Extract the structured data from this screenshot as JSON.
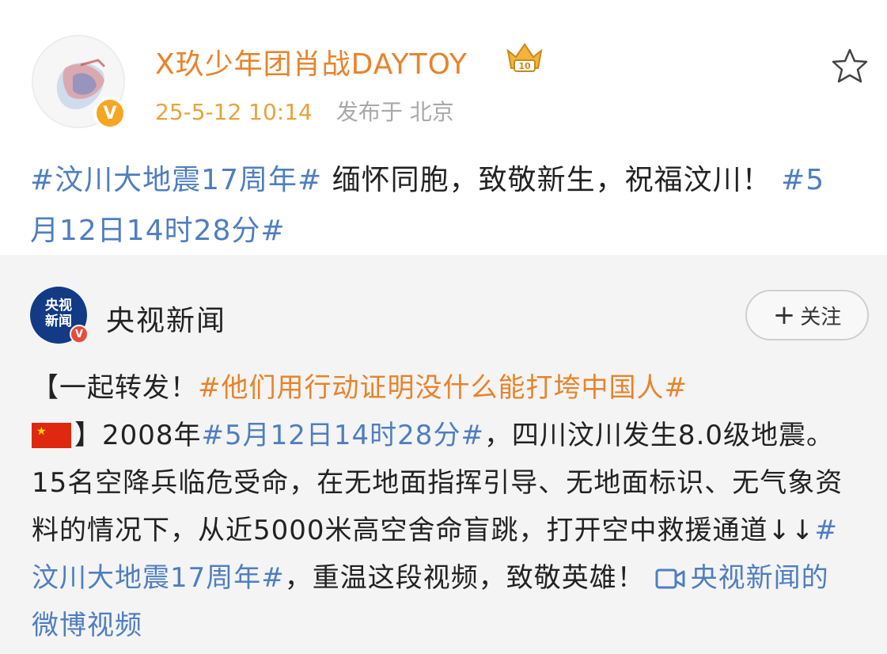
{
  "post": {
    "username": "X玖少年团肖战DAYTOY",
    "timestamp": "25-5-12 10:14",
    "location": "发布于 北京",
    "badge_number": "10",
    "verified_icon": "v-badge-icon",
    "text": {
      "tag1": "#汶川大地震17周年#",
      "body": " 缅怀同胞，致敬新生，祝福汶川！ ",
      "tag2": "#5月12日14时28分#"
    }
  },
  "repost": {
    "author_name": "央视新闻",
    "avatar_text_line1": "央视",
    "avatar_text_line2": "新闻",
    "follow_label": "关注",
    "text": {
      "open": "【一起转发！",
      "tag1": "#他们用行动证明没什么能打垮中国人#",
      "close": "】",
      "part1": "2008年",
      "tag2": "#5月12日14时28分#",
      "part2": "，四川汶川发生8.0级地震。15名空降兵临危受命，在无地面指挥引导、无地面标识、无气象资料的情况下，从近5000米高空舍命盲跳，打开空中救援通道↓↓",
      "tag3": "#汶川大地震17周年#",
      "part3": "，重温这段视频，致敬英雄！ ",
      "video_link": "央视新闻的微博视频"
    }
  },
  "colors": {
    "username": "#e8832a",
    "timestamp": "#e8a33a",
    "hashtag_blue": "#4f7ec0",
    "hashtag_orange": "#e8832a",
    "repost_background": "#f4f4f4"
  }
}
